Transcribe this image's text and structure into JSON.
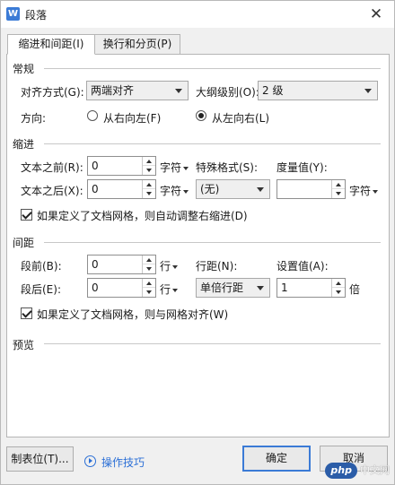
{
  "window": {
    "title": "段落",
    "app_icon_glyph": "W",
    "close_glyph": "✕"
  },
  "tabs": [
    {
      "label": "缩进和间距(I)",
      "active": true
    },
    {
      "label": "换行和分页(P)",
      "active": false
    }
  ],
  "general": {
    "section_label": "常规",
    "alignment_label": "对齐方式(G):",
    "alignment_value": "两端对齐",
    "outline_label": "大纲级别(O):",
    "outline_value": "2 级",
    "direction_label": "方向:",
    "rtl_label": "从右向左(F)",
    "ltr_label": "从左向右(L)",
    "direction_selected": "ltr"
  },
  "indent": {
    "section_label": "缩进",
    "before_label": "文本之前(R):",
    "before_value": "0",
    "before_unit": "字符",
    "after_label": "文本之后(X):",
    "after_value": "0",
    "after_unit": "字符",
    "special_label": "特殊格式(S):",
    "special_value": "(无)",
    "measure_label": "度量值(Y):",
    "measure_value": "",
    "measure_unit": "字符",
    "grid_checkbox_label": "如果定义了文档网格，则自动调整右缩进(D)",
    "grid_checked": true
  },
  "spacing": {
    "section_label": "间距",
    "before_label": "段前(B):",
    "before_value": "0",
    "before_unit": "行",
    "after_label": "段后(E):",
    "after_value": "0",
    "after_unit": "行",
    "line_spacing_label": "行距(N):",
    "line_spacing_value": "单倍行距",
    "setting_label": "设置值(A):",
    "setting_value": "1",
    "setting_unit": "倍",
    "grid_checkbox_label": "如果定义了文档网格，则与网格对齐(W)",
    "grid_checked": true
  },
  "preview": {
    "section_label": "预览"
  },
  "footer": {
    "tabs_button": "制表位(T)...",
    "tips_link": "操作技巧",
    "ok_button": "确定",
    "cancel_button": "取消"
  },
  "watermark": {
    "logo_text": "php",
    "site_text": "中文网"
  },
  "colors": {
    "accent": "#3b7bd6",
    "link": "#2b6fd6"
  }
}
